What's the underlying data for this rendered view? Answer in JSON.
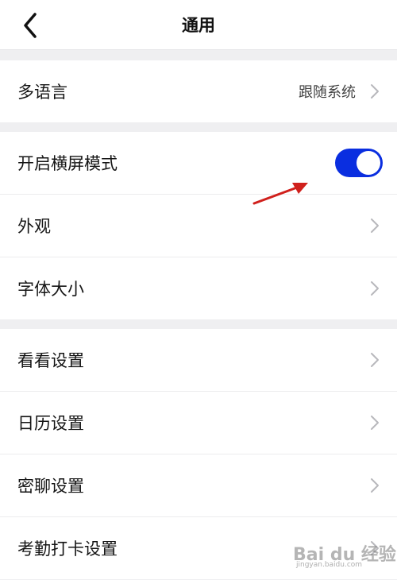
{
  "header": {
    "title": "通用",
    "back_icon": "chevron-left-icon"
  },
  "group1": {
    "items": [
      {
        "label": "多语言",
        "value": "跟随系统",
        "chevron": true
      }
    ]
  },
  "group2": {
    "items": [
      {
        "label": "开启横屏模式",
        "toggle_on": true
      },
      {
        "label": "外观",
        "chevron": true
      },
      {
        "label": "字体大小",
        "chevron": true
      }
    ]
  },
  "group3": {
    "items": [
      {
        "label": "看看设置",
        "chevron": true
      },
      {
        "label": "日历设置",
        "chevron": true
      },
      {
        "label": "密聊设置",
        "chevron": true
      },
      {
        "label": "考勤打卡设置",
        "chevron": true
      }
    ]
  },
  "annotation": {
    "arrow_color": "#d0201c"
  },
  "watermark": {
    "logo": "Bai du 经验",
    "url": "jingyan.baidu.com"
  },
  "colors": {
    "toggle_on": "#0a2ee0",
    "background": "#efeff1",
    "row_bg": "#ffffff",
    "chevron": "#b8b8bc"
  }
}
